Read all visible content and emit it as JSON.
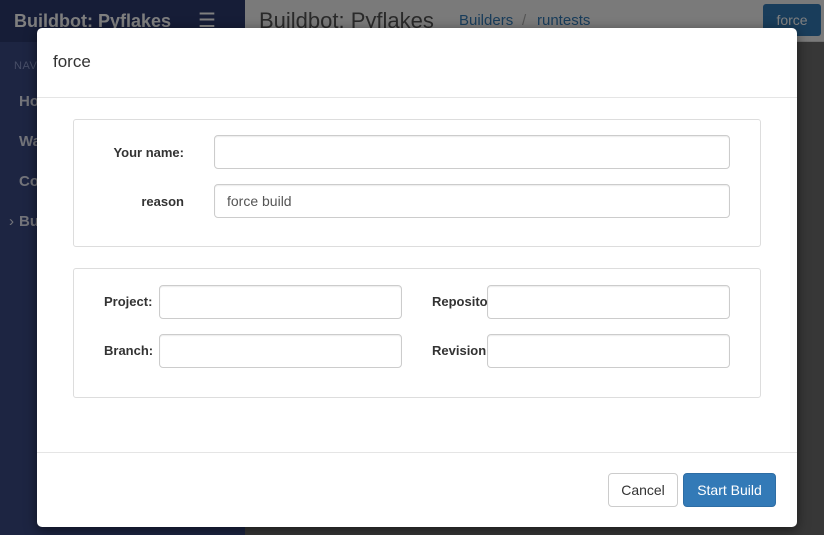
{
  "sidebar": {
    "brand": "Buildbot: Pyflakes",
    "section_label": "NAV",
    "items": [
      {
        "label": "Ho"
      },
      {
        "label": "Wa"
      },
      {
        "label": "Co"
      },
      {
        "label": "Bu"
      }
    ],
    "chevron": "›"
  },
  "topbar": {
    "title": "Buildbot: Pyflakes",
    "breadcrumbs": [
      "Builders",
      "runtests"
    ],
    "separator": "/",
    "force_label": "force"
  },
  "modal": {
    "title": "force",
    "your_name": {
      "label": "Your name:",
      "value": ""
    },
    "reason": {
      "label": "reason",
      "value": "force build"
    },
    "project": {
      "label": "Project:",
      "value": ""
    },
    "repository": {
      "label": "Repository:",
      "value": ""
    },
    "branch": {
      "label": "Branch:",
      "value": ""
    },
    "revision": {
      "label": "Revision:",
      "value": ""
    },
    "cancel_label": "Cancel",
    "start_label": "Start Build"
  },
  "icons": {
    "menu": "hamburger-icon",
    "chevron": "chevron-right-icon"
  },
  "colors": {
    "primary": "#337ab7",
    "sidebar": "#3b4b84"
  }
}
